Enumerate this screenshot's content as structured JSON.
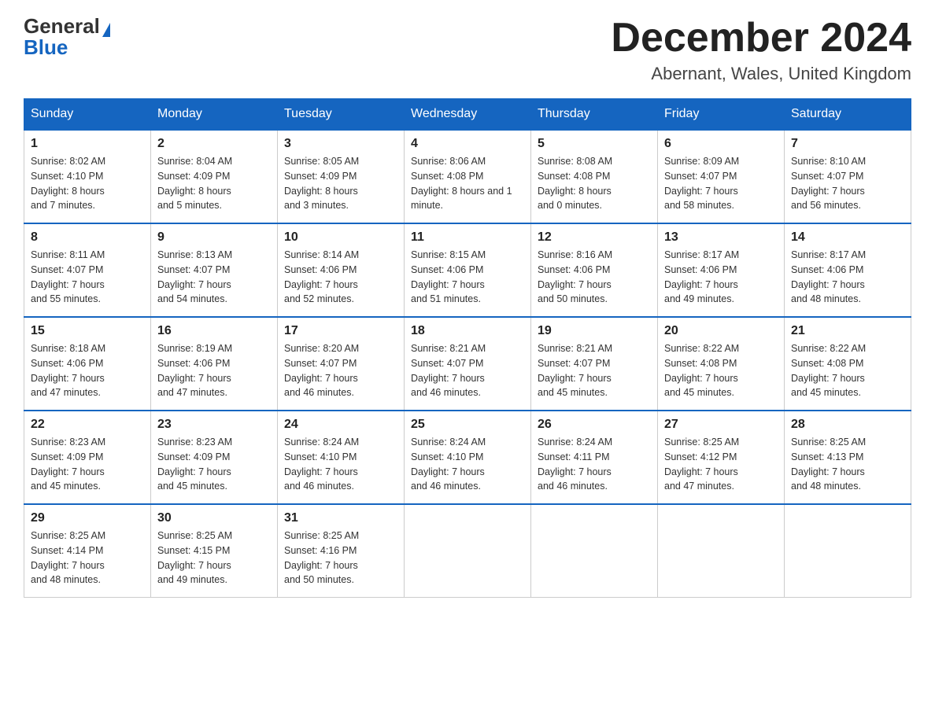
{
  "header": {
    "logo_general": "General",
    "logo_blue": "Blue",
    "month_title": "December 2024",
    "location": "Abernant, Wales, United Kingdom"
  },
  "weekdays": [
    "Sunday",
    "Monday",
    "Tuesday",
    "Wednesday",
    "Thursday",
    "Friday",
    "Saturday"
  ],
  "weeks": [
    [
      {
        "day": "1",
        "sunrise": "8:02 AM",
        "sunset": "4:10 PM",
        "daylight": "8 hours and 7 minutes."
      },
      {
        "day": "2",
        "sunrise": "8:04 AM",
        "sunset": "4:09 PM",
        "daylight": "8 hours and 5 minutes."
      },
      {
        "day": "3",
        "sunrise": "8:05 AM",
        "sunset": "4:09 PM",
        "daylight": "8 hours and 3 minutes."
      },
      {
        "day": "4",
        "sunrise": "8:06 AM",
        "sunset": "4:08 PM",
        "daylight": "8 hours and 1 minute."
      },
      {
        "day": "5",
        "sunrise": "8:08 AM",
        "sunset": "4:08 PM",
        "daylight": "8 hours and 0 minutes."
      },
      {
        "day": "6",
        "sunrise": "8:09 AM",
        "sunset": "4:07 PM",
        "daylight": "7 hours and 58 minutes."
      },
      {
        "day": "7",
        "sunrise": "8:10 AM",
        "sunset": "4:07 PM",
        "daylight": "7 hours and 56 minutes."
      }
    ],
    [
      {
        "day": "8",
        "sunrise": "8:11 AM",
        "sunset": "4:07 PM",
        "daylight": "7 hours and 55 minutes."
      },
      {
        "day": "9",
        "sunrise": "8:13 AM",
        "sunset": "4:07 PM",
        "daylight": "7 hours and 54 minutes."
      },
      {
        "day": "10",
        "sunrise": "8:14 AM",
        "sunset": "4:06 PM",
        "daylight": "7 hours and 52 minutes."
      },
      {
        "day": "11",
        "sunrise": "8:15 AM",
        "sunset": "4:06 PM",
        "daylight": "7 hours and 51 minutes."
      },
      {
        "day": "12",
        "sunrise": "8:16 AM",
        "sunset": "4:06 PM",
        "daylight": "7 hours and 50 minutes."
      },
      {
        "day": "13",
        "sunrise": "8:17 AM",
        "sunset": "4:06 PM",
        "daylight": "7 hours and 49 minutes."
      },
      {
        "day": "14",
        "sunrise": "8:17 AM",
        "sunset": "4:06 PM",
        "daylight": "7 hours and 48 minutes."
      }
    ],
    [
      {
        "day": "15",
        "sunrise": "8:18 AM",
        "sunset": "4:06 PM",
        "daylight": "7 hours and 47 minutes."
      },
      {
        "day": "16",
        "sunrise": "8:19 AM",
        "sunset": "4:06 PM",
        "daylight": "7 hours and 47 minutes."
      },
      {
        "day": "17",
        "sunrise": "8:20 AM",
        "sunset": "4:07 PM",
        "daylight": "7 hours and 46 minutes."
      },
      {
        "day": "18",
        "sunrise": "8:21 AM",
        "sunset": "4:07 PM",
        "daylight": "7 hours and 46 minutes."
      },
      {
        "day": "19",
        "sunrise": "8:21 AM",
        "sunset": "4:07 PM",
        "daylight": "7 hours and 45 minutes."
      },
      {
        "day": "20",
        "sunrise": "8:22 AM",
        "sunset": "4:08 PM",
        "daylight": "7 hours and 45 minutes."
      },
      {
        "day": "21",
        "sunrise": "8:22 AM",
        "sunset": "4:08 PM",
        "daylight": "7 hours and 45 minutes."
      }
    ],
    [
      {
        "day": "22",
        "sunrise": "8:23 AM",
        "sunset": "4:09 PM",
        "daylight": "7 hours and 45 minutes."
      },
      {
        "day": "23",
        "sunrise": "8:23 AM",
        "sunset": "4:09 PM",
        "daylight": "7 hours and 45 minutes."
      },
      {
        "day": "24",
        "sunrise": "8:24 AM",
        "sunset": "4:10 PM",
        "daylight": "7 hours and 46 minutes."
      },
      {
        "day": "25",
        "sunrise": "8:24 AM",
        "sunset": "4:10 PM",
        "daylight": "7 hours and 46 minutes."
      },
      {
        "day": "26",
        "sunrise": "8:24 AM",
        "sunset": "4:11 PM",
        "daylight": "7 hours and 46 minutes."
      },
      {
        "day": "27",
        "sunrise": "8:25 AM",
        "sunset": "4:12 PM",
        "daylight": "7 hours and 47 minutes."
      },
      {
        "day": "28",
        "sunrise": "8:25 AM",
        "sunset": "4:13 PM",
        "daylight": "7 hours and 48 minutes."
      }
    ],
    [
      {
        "day": "29",
        "sunrise": "8:25 AM",
        "sunset": "4:14 PM",
        "daylight": "7 hours and 48 minutes."
      },
      {
        "day": "30",
        "sunrise": "8:25 AM",
        "sunset": "4:15 PM",
        "daylight": "7 hours and 49 minutes."
      },
      {
        "day": "31",
        "sunrise": "8:25 AM",
        "sunset": "4:16 PM",
        "daylight": "7 hours and 50 minutes."
      },
      null,
      null,
      null,
      null
    ]
  ],
  "labels": {
    "sunrise": "Sunrise:",
    "sunset": "Sunset:",
    "daylight": "Daylight:"
  }
}
